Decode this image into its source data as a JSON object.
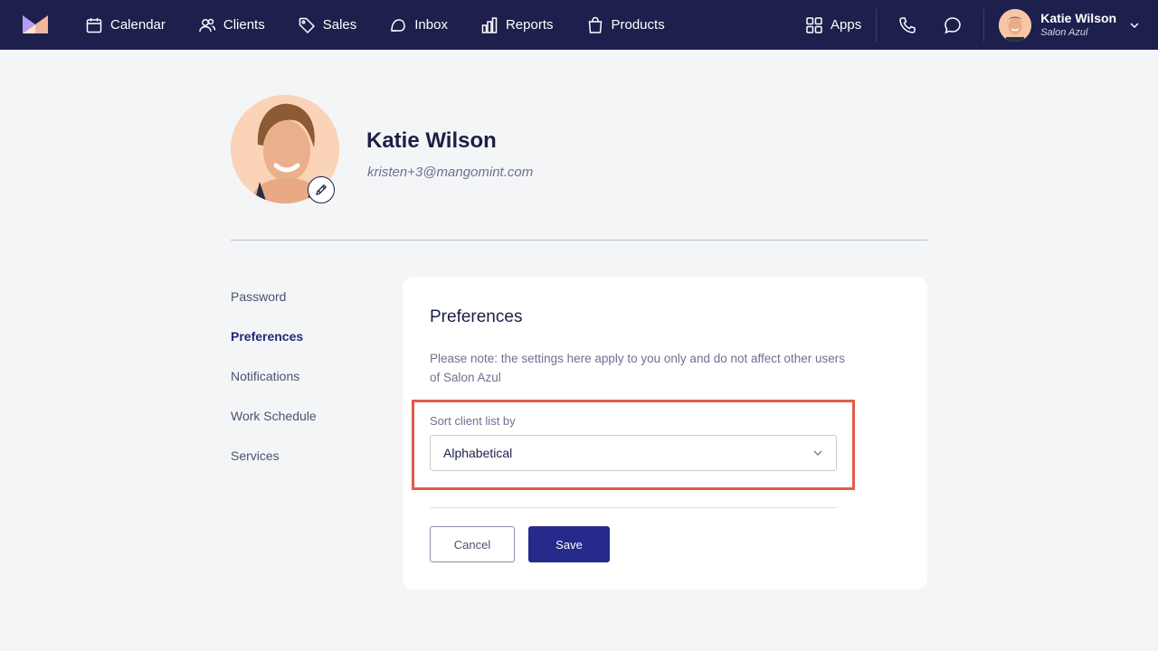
{
  "colors": {
    "nav_bg": "#1d1f4c",
    "page_bg": "#f4f5f7",
    "primary": "#262a8a",
    "highlight": "#e35b4a"
  },
  "nav": {
    "logo_icon": "mangomint-logo-icon",
    "items": [
      {
        "label": "Calendar",
        "icon": "calendar-icon"
      },
      {
        "label": "Clients",
        "icon": "users-icon"
      },
      {
        "label": "Sales",
        "icon": "tag-icon"
      },
      {
        "label": "Inbox",
        "icon": "inbox-icon"
      },
      {
        "label": "Reports",
        "icon": "bar-chart-icon"
      },
      {
        "label": "Products",
        "icon": "shopping-bag-icon"
      }
    ],
    "apps_label": "Apps",
    "user": {
      "name": "Katie Wilson",
      "org": "Salon Azul"
    }
  },
  "profile": {
    "name": "Katie Wilson",
    "email": "kristen+3@mangomint.com"
  },
  "side_menu": {
    "items": [
      "Password",
      "Preferences",
      "Notifications",
      "Work Schedule",
      "Services"
    ],
    "active": "Preferences"
  },
  "preferences": {
    "title": "Preferences",
    "note": "Please note: the settings here apply to you only and do not affect other users of Salon Azul",
    "sort_label": "Sort client list by",
    "sort_value": "Alphabetical",
    "cancel_label": "Cancel",
    "save_label": "Save"
  }
}
